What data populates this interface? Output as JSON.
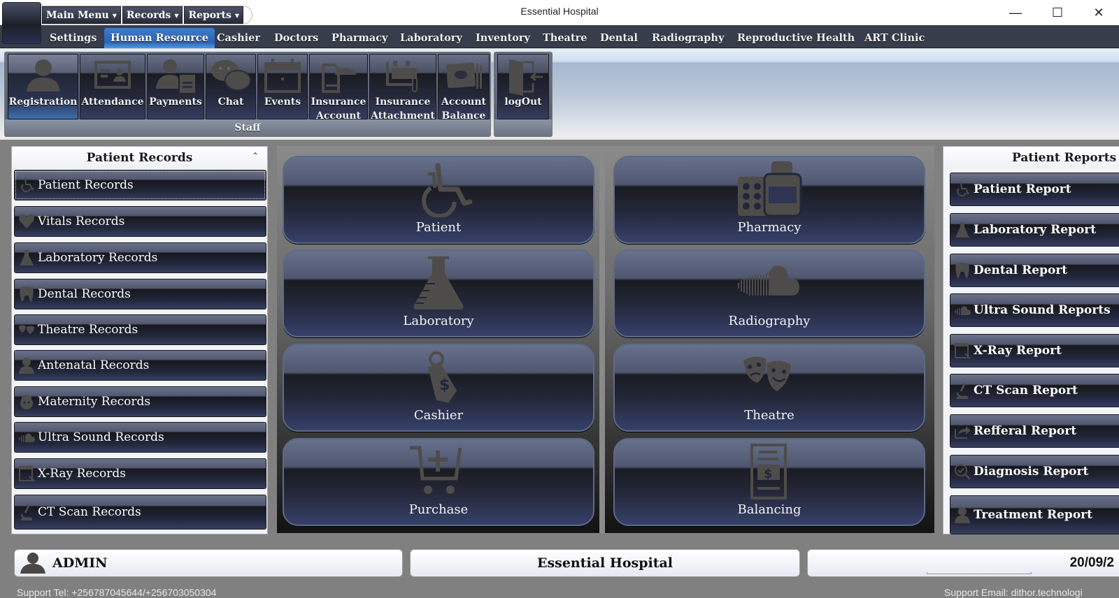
{
  "window": {
    "title": "Essential Hospital",
    "controls": {
      "minimize": "—",
      "maximize": "☐",
      "close": "✕"
    }
  },
  "quick_access": [
    {
      "label": "Main Menu",
      "caret": "▼"
    },
    {
      "label": "Records",
      "caret": "▼"
    },
    {
      "label": "Reports",
      "caret": "▼"
    }
  ],
  "tabs": [
    {
      "label": "Settings",
      "active": false
    },
    {
      "label": "Human Resource",
      "active": true
    },
    {
      "label": "Cashier",
      "active": false
    },
    {
      "label": "Doctors",
      "active": false
    },
    {
      "label": "Pharmacy",
      "active": false
    },
    {
      "label": "Laboratory",
      "active": false
    },
    {
      "label": "Inventory",
      "active": false
    },
    {
      "label": "Theatre",
      "active": false
    },
    {
      "label": "Dental",
      "active": false
    },
    {
      "label": "Radiography",
      "active": false
    },
    {
      "label": "Reproductive Health",
      "active": false
    },
    {
      "label": "ART Clinic",
      "active": false
    }
  ],
  "ribbon": {
    "staff_group": {
      "label": "Staff",
      "buttons": [
        {
          "label": "Registration",
          "icon": "user-icon",
          "selected": true
        },
        {
          "label": "Attendance",
          "icon": "id-card-icon"
        },
        {
          "label": "Payments",
          "icon": "user-invoice-icon"
        },
        {
          "label": "Chat",
          "icon": "chat-bubbles-icon"
        },
        {
          "label": "Events",
          "icon": "calendar-icon"
        },
        {
          "label": "Insurance\nAccount",
          "line1": "Insurance",
          "line2": "Account",
          "icon": "insurance-umbrella-icon"
        },
        {
          "label": "Insurance\nAttachment",
          "line1": "Insurance",
          "line2": "Attachment",
          "icon": "attachment-icon"
        },
        {
          "label": "Account\nBalance",
          "line1": "Account",
          "line2": "Balance",
          "icon": "wallet-icon"
        }
      ]
    },
    "logout_group": {
      "buttons": [
        {
          "label": "logOut",
          "icon": "logout-door-icon"
        }
      ]
    }
  },
  "patient_records": {
    "title": "Patient Records",
    "collapse_icon": "⌃",
    "items": [
      {
        "label": "Patient Records",
        "icon": "wheelchair-icon"
      },
      {
        "label": "Vitals Records",
        "icon": "heart-icon"
      },
      {
        "label": "Laboratory Records",
        "icon": "flask-icon"
      },
      {
        "label": "Dental Records",
        "icon": "tooth-icon"
      },
      {
        "label": "Theatre Records",
        "icon": "theatre-masks-icon"
      },
      {
        "label": "Antenatal Records",
        "icon": "doctor-icon"
      },
      {
        "label": "Maternity Records",
        "icon": "nurse-icon"
      },
      {
        "label": "Ultra Sound Records",
        "icon": "ultrasound-icon"
      },
      {
        "label": "X-Ray Records",
        "icon": "xray-icon"
      },
      {
        "label": "CT Scan Records",
        "icon": "microscope-icon"
      }
    ]
  },
  "modules": [
    {
      "label": "Patient",
      "icon": "wheelchair-icon"
    },
    {
      "label": "Pharmacy",
      "icon": "pills-bottle-icon"
    },
    {
      "label": "Laboratory",
      "icon": "flask-icon"
    },
    {
      "label": "Radiography",
      "icon": "ultrasound-icon"
    },
    {
      "label": "Cashier",
      "icon": "price-tag-icon"
    },
    {
      "label": "Theatre",
      "icon": "theatre-masks-icon"
    },
    {
      "label": "Purchase",
      "icon": "cart-plus-icon"
    },
    {
      "label": "Balancing",
      "icon": "invoice-dollar-icon"
    }
  ],
  "patient_reports": {
    "title": "Patient Reports",
    "items": [
      {
        "label": "Patient Report",
        "icon": "wheelchair-icon"
      },
      {
        "label": "Laboratory Report",
        "icon": "flask-icon"
      },
      {
        "label": "Dental Report",
        "icon": "tooth-icon"
      },
      {
        "label": "Ultra Sound Reports",
        "icon": "ultrasound-icon"
      },
      {
        "label": "X-Ray Report",
        "icon": "xray-icon"
      },
      {
        "label": "CT Scan Report",
        "icon": "microscope-icon"
      },
      {
        "label": "Refferal Report",
        "icon": "share-arrow-icon"
      },
      {
        "label": "Diagnosis Report",
        "icon": "search-check-icon"
      },
      {
        "label": "Treatment Report",
        "icon": "doctor-icon"
      }
    ]
  },
  "status_bar": {
    "user": "ADMIN",
    "hospital": "Essential Hospital",
    "date": "20/09/2"
  },
  "support": {
    "tel": "Support Tel: +256787045644/+256703050304",
    "email": "Support Email: dithor.technologi"
  },
  "colors": {
    "active_tab": "#2e63b0",
    "tab_bar": "#383d4c",
    "button_dark": "#22263a",
    "icon_gray": "#4e4c4a",
    "background": "#808080"
  }
}
